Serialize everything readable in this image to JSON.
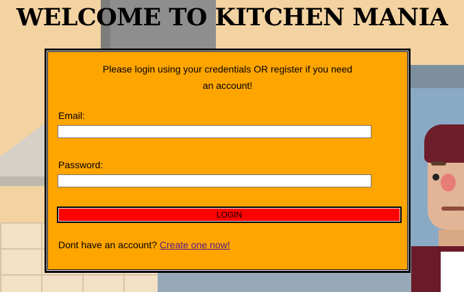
{
  "page": {
    "title": "WELCOME TO KITCHEN MANIA"
  },
  "login": {
    "intro_line1": "Please login using your credentials OR register if you need",
    "intro_line2": "an account!",
    "email_label": "Email:",
    "email_value": "",
    "password_label": "Password:",
    "password_value": "",
    "login_button": "LOGIN",
    "signup_prompt": "Dont have an account?",
    "signup_link": "Create one now!"
  },
  "colors": {
    "background": "#f4d3a2",
    "card": "#ffa500",
    "login_button": "#ff0000",
    "link": "#551a8b"
  }
}
